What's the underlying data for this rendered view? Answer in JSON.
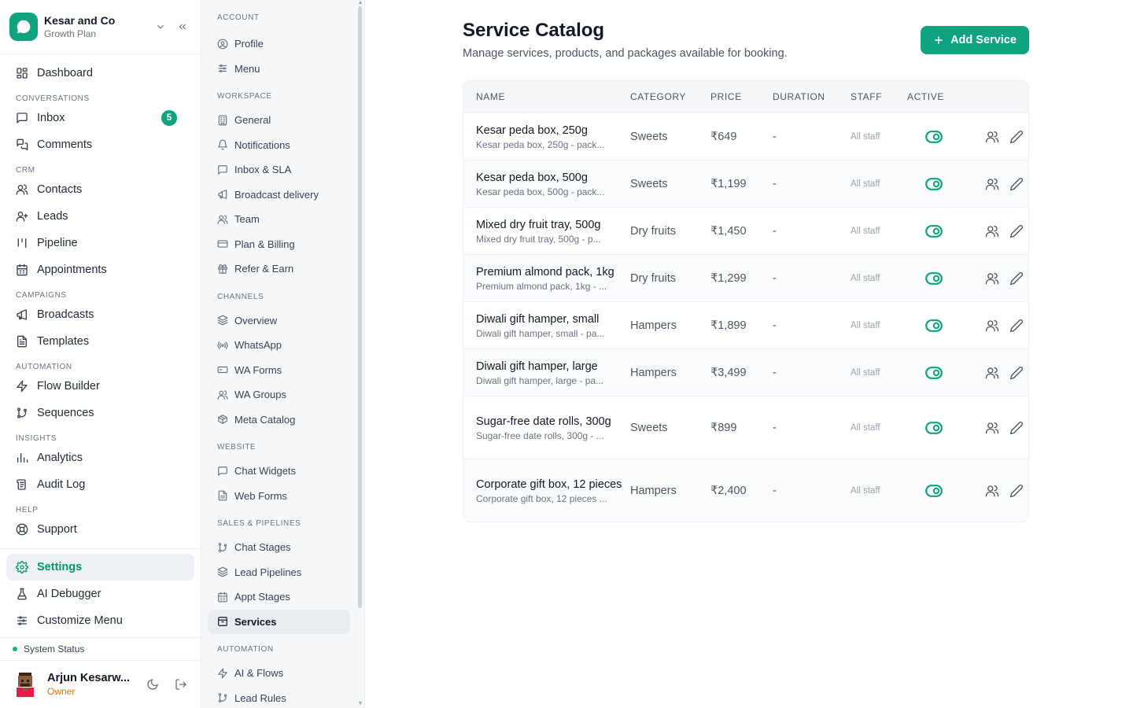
{
  "brand": {
    "name": "Kesar and Co",
    "plan": "Growth Plan"
  },
  "sidebar": {
    "items": [
      {
        "type": "item",
        "label": "Dashboard",
        "icon": "dashboard-icon"
      },
      {
        "type": "section",
        "label": "CONVERSATIONS"
      },
      {
        "type": "item",
        "label": "Inbox",
        "icon": "inbox-icon",
        "badge": "5"
      },
      {
        "type": "item",
        "label": "Comments",
        "icon": "comments-icon"
      },
      {
        "type": "section",
        "label": "CRM"
      },
      {
        "type": "item",
        "label": "Contacts",
        "icon": "contacts-icon"
      },
      {
        "type": "item",
        "label": "Leads",
        "icon": "leads-icon"
      },
      {
        "type": "item",
        "label": "Pipeline",
        "icon": "pipeline-icon"
      },
      {
        "type": "item",
        "label": "Appointments",
        "icon": "calendar-icon"
      },
      {
        "type": "section",
        "label": "CAMPAIGNS"
      },
      {
        "type": "item",
        "label": "Broadcasts",
        "icon": "megaphone-icon"
      },
      {
        "type": "item",
        "label": "Templates",
        "icon": "template-icon"
      },
      {
        "type": "section",
        "label": "AUTOMATION"
      },
      {
        "type": "item",
        "label": "Flow Builder",
        "icon": "bolt-icon"
      },
      {
        "type": "item",
        "label": "Sequences",
        "icon": "sequence-icon"
      },
      {
        "type": "section",
        "label": "INSIGHTS"
      },
      {
        "type": "item",
        "label": "Analytics",
        "icon": "analytics-icon"
      },
      {
        "type": "item",
        "label": "Audit Log",
        "icon": "audit-icon"
      },
      {
        "type": "section",
        "label": "HELP"
      },
      {
        "type": "item",
        "label": "Support",
        "icon": "support-icon"
      }
    ],
    "bottom_items": [
      {
        "label": "Settings",
        "icon": "gear-icon",
        "active": true
      },
      {
        "label": "AI Debugger",
        "icon": "flask-icon"
      },
      {
        "label": "Customize Menu",
        "icon": "sliders-icon"
      }
    ],
    "system_status": "System Status",
    "user": {
      "name": "Arjun Kesarw...",
      "role": "Owner"
    }
  },
  "subnav": {
    "groups": [
      {
        "title": "ACCOUNT",
        "items": [
          {
            "label": "Profile",
            "icon": "profile-icon"
          },
          {
            "label": "Menu",
            "icon": "sliders-icon"
          }
        ]
      },
      {
        "title": "WORKSPACE",
        "items": [
          {
            "label": "General",
            "icon": "building-icon"
          },
          {
            "label": "Notifications",
            "icon": "bell-icon"
          },
          {
            "label": "Inbox & SLA",
            "icon": "message-icon"
          },
          {
            "label": "Broadcast delivery",
            "icon": "megaphone-icon"
          },
          {
            "label": "Team",
            "icon": "team-icon"
          },
          {
            "label": "Plan & Billing",
            "icon": "card-icon"
          },
          {
            "label": "Refer & Earn",
            "icon": "gift-icon"
          }
        ]
      },
      {
        "title": "CHANNELS",
        "items": [
          {
            "label": "Overview",
            "icon": "layers-icon"
          },
          {
            "label": "WhatsApp",
            "icon": "broadcast-signal-icon"
          },
          {
            "label": "WA Forms",
            "icon": "form-icon"
          },
          {
            "label": "WA Groups",
            "icon": "team-icon"
          },
          {
            "label": "Meta Catalog",
            "icon": "box-icon"
          }
        ]
      },
      {
        "title": "WEBSITE",
        "items": [
          {
            "label": "Chat Widgets",
            "icon": "message-icon"
          },
          {
            "label": "Web Forms",
            "icon": "document-icon"
          }
        ]
      },
      {
        "title": "SALES & PIPELINES",
        "items": [
          {
            "label": "Chat Stages",
            "icon": "branch-icon"
          },
          {
            "label": "Lead Pipelines",
            "icon": "layers-icon"
          },
          {
            "label": "Appt Stages",
            "icon": "calendar-icon"
          },
          {
            "label": "Services",
            "icon": "package-icon",
            "active": true
          }
        ]
      },
      {
        "title": "AUTOMATION",
        "items": [
          {
            "label": "AI & Flows",
            "icon": "bolt-icon"
          },
          {
            "label": "Lead Rules",
            "icon": "branch-icon"
          }
        ]
      }
    ]
  },
  "header": {
    "title": "Service Catalog",
    "subtitle": "Manage services, products, and packages available for booking.",
    "add_button": "Add Service"
  },
  "table": {
    "columns": [
      "NAME",
      "CATEGORY",
      "PRICE",
      "DURATION",
      "STAFF",
      "ACTIVE"
    ],
    "rows": [
      {
        "name": "Kesar peda box, 250g",
        "desc": "Kesar peda box, 250g - pack...",
        "category": "Sweets",
        "price": "₹649",
        "duration": "-",
        "staff": "All staff",
        "active": true
      },
      {
        "name": "Kesar peda box, 500g",
        "desc": "Kesar peda box, 500g - pack...",
        "category": "Sweets",
        "price": "₹1,199",
        "duration": "-",
        "staff": "All staff",
        "active": true
      },
      {
        "name": "Mixed dry fruit tray, 500g",
        "desc": "Mixed dry fruit tray, 500g - p...",
        "category": "Dry fruits",
        "price": "₹1,450",
        "duration": "-",
        "staff": "All staff",
        "active": true
      },
      {
        "name": "Premium almond pack, 1kg",
        "desc": "Premium almond pack, 1kg - ...",
        "category": "Dry fruits",
        "price": "₹1,299",
        "duration": "-",
        "staff": "All staff",
        "active": true
      },
      {
        "name": "Diwali gift hamper, small",
        "desc": "Diwali gift hamper, small - pa...",
        "category": "Hampers",
        "price": "₹1,899",
        "duration": "-",
        "staff": "All staff",
        "active": true
      },
      {
        "name": "Diwali gift hamper, large",
        "desc": "Diwali gift hamper, large - pa...",
        "category": "Hampers",
        "price": "₹3,499",
        "duration": "-",
        "staff": "All staff",
        "active": true
      },
      {
        "name": "Sugar-free date rolls, 300g",
        "desc": "Sugar-free date rolls, 300g - ...",
        "category": "Sweets",
        "price": "₹899",
        "duration": "-",
        "staff": "All staff",
        "active": true
      },
      {
        "name": "Corporate gift box, 12 pieces",
        "desc": "Corporate gift box, 12 pieces ...",
        "category": "Hampers",
        "price": "₹2,400",
        "duration": "-",
        "staff": "All staff",
        "active": true
      }
    ]
  },
  "colors": {
    "accent": "#10a37f",
    "badge": "#10a37f",
    "owner": "#d97706"
  }
}
